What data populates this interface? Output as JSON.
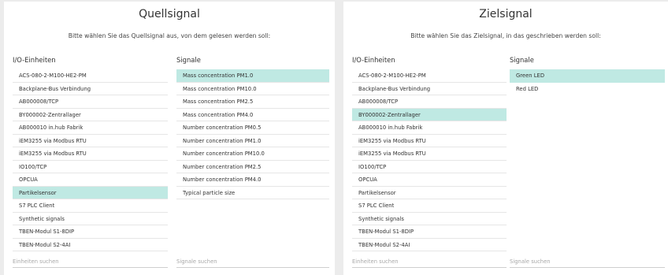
{
  "source": {
    "title": "Quellsignal",
    "subtitle": "Bitte wählen Sie das Quellsignal aus, von dem gelesen werden soll:",
    "units_header": "I/O-Einheiten",
    "signals_header": "Signale",
    "units": [
      "ACS-080-2-M100-HE2-PM",
      "Backplane-Bus Verbindung",
      "AB000008/TCP",
      "BY000002-Zentrallager",
      "AB000010   in.hub Fabrik",
      "iEM3255 via Modbus RTU",
      "iEM3255 via Modbus RTU",
      "IO100/TCP",
      "OPCUA",
      "Partikelsensor",
      "S7 PLC Client",
      "Synthetic signals",
      "TBEN-Modul S1-8DIP",
      "TBEN-Modul S2-4AI"
    ],
    "selected_unit": "Partikelsensor",
    "signals": [
      "Mass concentration PM1.0",
      "Mass concentration PM10.0",
      "Mass concentration PM2.5",
      "Mass concentration PM4.0",
      "Number concentration PM0.5",
      "Number concentration PM1.0",
      "Number concentration PM10.0",
      "Number concentration PM2.5",
      "Number concentration PM4.0",
      "Typical particle size"
    ],
    "selected_signal": "Mass concentration PM1.0",
    "units_search_placeholder": "Einheiten suchen",
    "signals_search_placeholder": "Signale suchen"
  },
  "target": {
    "title": "Zielsignal",
    "subtitle": "Bitte wählen Sie das Zielsignal, in das geschrieben werden soll:",
    "units_header": "I/O-Einheiten",
    "signals_header": "Signale",
    "units": [
      "ACS-080-2-M100-HE2-PM",
      "Backplane-Bus Verbindung",
      "AB000008/TCP",
      "BY000002-Zentrallager",
      "AB000010   in.hub Fabrik",
      "iEM3255 via Modbus RTU",
      "iEM3255 via Modbus RTU",
      "IO100/TCP",
      "OPCUA",
      "Partikelsensor",
      "S7 PLC Client",
      "Synthetic signals",
      "TBEN-Modul S1-8DIP",
      "TBEN-Modul S2-4AI"
    ],
    "selected_unit": "BY000002-Zentrallager",
    "signals": [
      "Green LED",
      "Red LED"
    ],
    "selected_signal": "Green LED",
    "units_search_placeholder": "Einheiten suchen",
    "signals_search_placeholder": "Signale suchen"
  },
  "colors": {
    "selected_background": "#bfe9e3",
    "panel_background": "#ffffff",
    "page_background": "#ececec"
  }
}
